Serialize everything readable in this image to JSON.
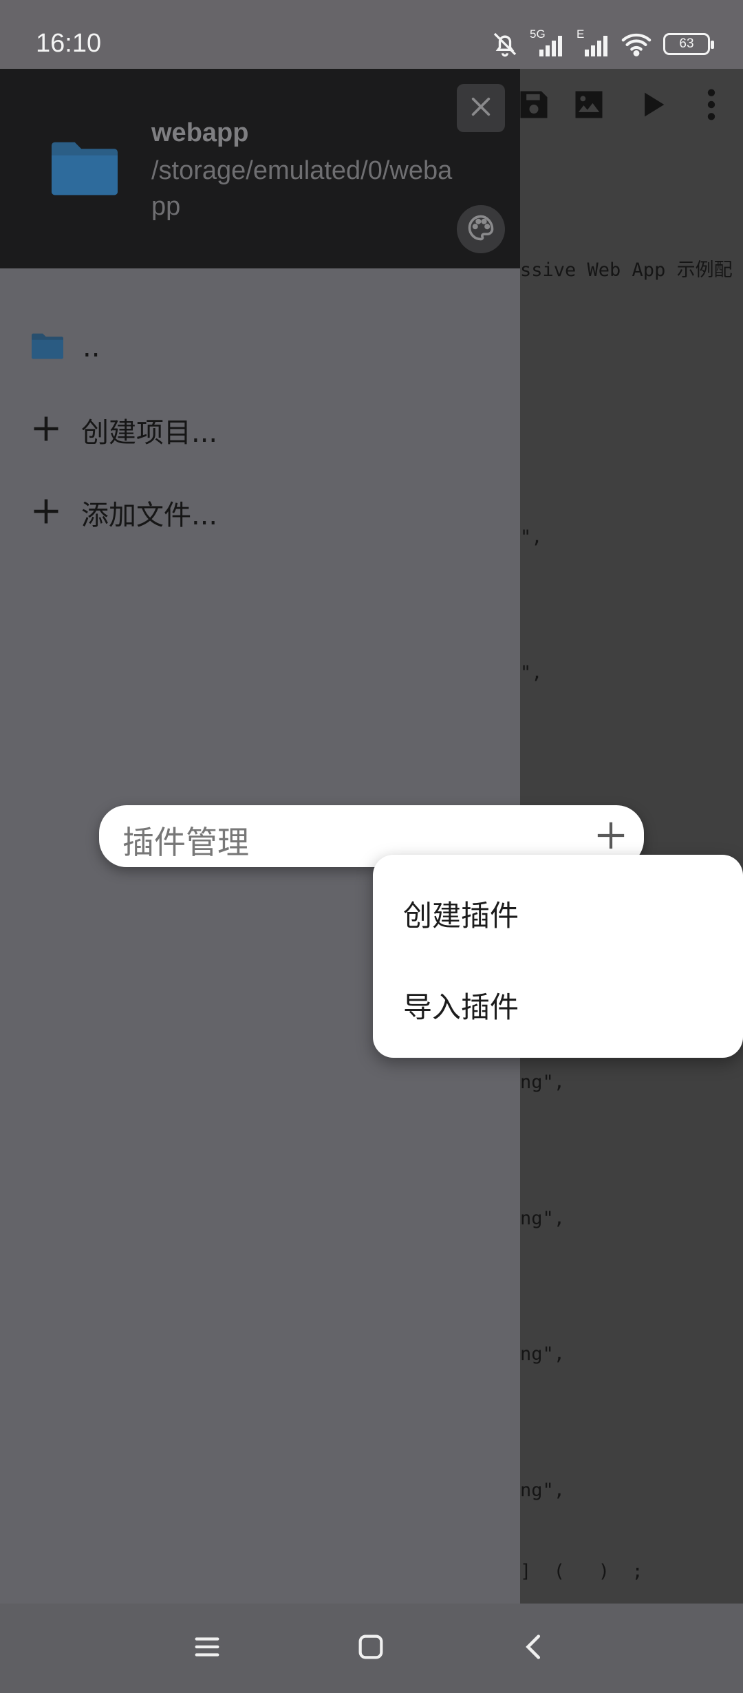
{
  "status_bar": {
    "time": "16:10",
    "network_primary": "5G",
    "network_secondary": "E",
    "battery_percent": "63"
  },
  "drawer": {
    "project_name": "webapp",
    "project_path": "/storage/emulated/0/webapp",
    "items": [
      {
        "label": ".."
      },
      {
        "label": "创建项目..."
      },
      {
        "label": "添加文件..."
      }
    ]
  },
  "editor": {
    "code_lines": [
      "ssive Web App 示例配",
      "\",",
      "\",",
      "ng\",",
      "ng\",",
      "ng\",",
      "ng\",",
      "]  (   )  ;"
    ]
  },
  "plugin_manager": {
    "title": "插件管理",
    "menu": [
      {
        "label": "创建插件"
      },
      {
        "label": "导入插件"
      }
    ]
  },
  "colors": {
    "folder": "#2e6b9c",
    "drawer_bg": "#646469",
    "header_bg": "#1b1b1c",
    "editor_bg": "#404040"
  }
}
